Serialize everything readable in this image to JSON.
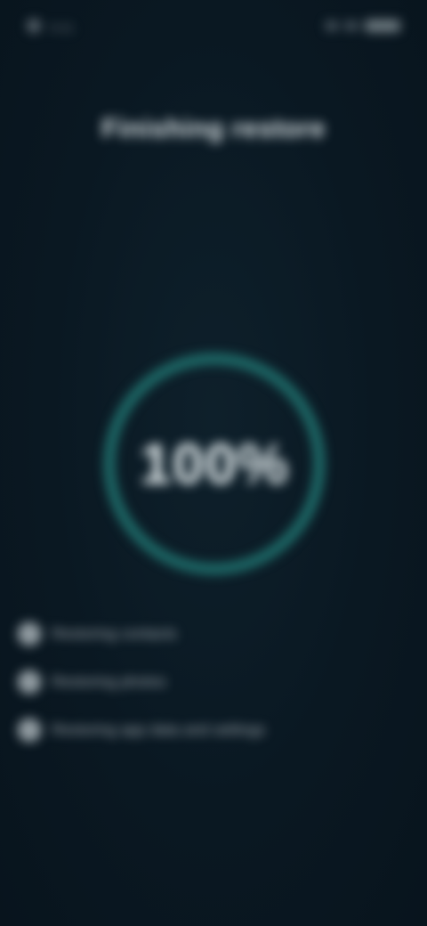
{
  "status_bar": {
    "time": "9:41"
  },
  "screen": {
    "title": "Finishing restore"
  },
  "progress": {
    "percent_label": "100%",
    "value": 1.0,
    "ring_color": "#1f6f6c",
    "track_color": "#143c3f"
  },
  "steps": [
    {
      "label": "Restoring contacts",
      "icon": "check-icon"
    },
    {
      "label": "Restoring photos",
      "icon": "check-icon"
    },
    {
      "label": "Restoring app data and settings",
      "icon": "check-icon"
    }
  ]
}
